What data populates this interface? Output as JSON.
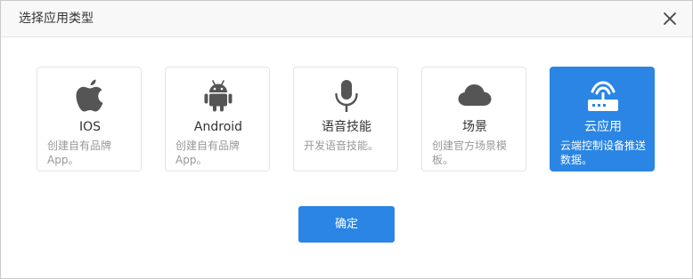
{
  "dialog": {
    "title": "选择应用类型",
    "close_icon": "close-icon",
    "confirm_label": "确定",
    "accent_color": "#2a85e4"
  },
  "cards": [
    {
      "id": "ios",
      "name": "IOS",
      "desc": "创建自有品牌App。",
      "icon": "apple-icon",
      "selected": false
    },
    {
      "id": "android",
      "name": "Android",
      "desc": "创建自有品牌App。",
      "icon": "android-icon",
      "selected": false
    },
    {
      "id": "voice",
      "name": "语音技能",
      "desc": "开发语音技能。",
      "icon": "microphone-icon",
      "selected": false
    },
    {
      "id": "scene",
      "name": "场景",
      "desc": "创建官方场景模板。",
      "icon": "cloud-icon",
      "selected": false
    },
    {
      "id": "cloud",
      "name": "云应用",
      "desc": "云端控制设备推送数据。",
      "icon": "router-icon",
      "selected": true
    }
  ]
}
